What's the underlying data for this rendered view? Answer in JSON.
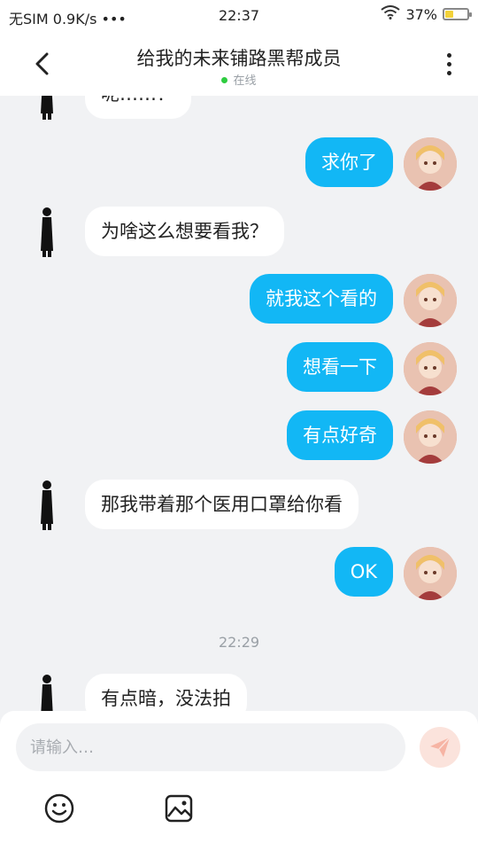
{
  "status_bar": {
    "carrier": "无SIM 0.9K/s •••",
    "time": "22:37",
    "battery": "37%",
    "battery_level": 0.37,
    "battery_color": "#f3d23a"
  },
  "header": {
    "title": "给我的未来铺路黑帮成员",
    "presence": "在线",
    "presence_color": "#2ecc40"
  },
  "messages": [
    {
      "from": "them",
      "text": "呢……？"
    },
    {
      "from": "me",
      "text": "求你了"
    },
    {
      "from": "them",
      "text": "为啥这么想要看我？"
    },
    {
      "from": "me",
      "text": "就我这个看的"
    },
    {
      "from": "me",
      "text": "想看一下"
    },
    {
      "from": "me",
      "text": "有点好奇"
    },
    {
      "from": "them",
      "text": "那我带着那个医用口罩给你看"
    },
    {
      "from": "me",
      "text": "OK"
    },
    {
      "from": "time",
      "text": "22:29"
    },
    {
      "from": "them",
      "text": "有点暗，没法拍"
    }
  ],
  "input": {
    "placeholder": "请输入…"
  },
  "colors": {
    "outgoing_bubble": "#12b7f5",
    "incoming_bubble": "#ffffff",
    "background": "#f1f2f4"
  },
  "icons": {
    "back": "back-chevron-icon",
    "more": "more-vertical-icon",
    "send": "send-icon",
    "emoji": "emoji-icon",
    "image": "image-icon"
  }
}
